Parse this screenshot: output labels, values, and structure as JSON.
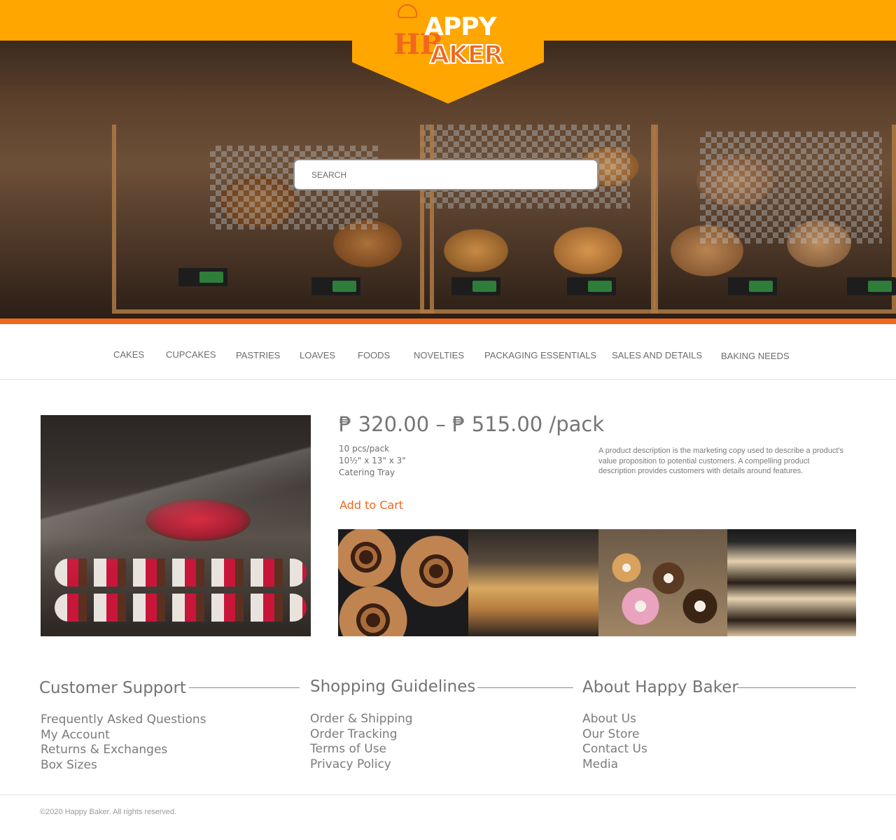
{
  "brand": {
    "logo_line1": "APPY",
    "logo_line2": "AKER",
    "logo_mark": "HB",
    "colors": {
      "orange": "#ffa600",
      "accent": "#f0671d"
    }
  },
  "search": {
    "placeholder": "SEARCH"
  },
  "nav": {
    "items": [
      "CAKES",
      "CUPCAKES",
      "PASTRIES",
      "LOAVES",
      "FOODS",
      "NOVELTIES",
      "PACKAGING ESSENTIALS",
      "SALES AND DETAILS",
      "BAKING NEEDS"
    ]
  },
  "product": {
    "price": "₱ 320.00 – ₱ 515.00 /pack",
    "spec_pack": "10 pcs/pack",
    "spec_size": "10½\" x 13\" x 3\"",
    "spec_type": "Catering Tray",
    "description": "A product description is the marketing copy used to describe a product's value proposition to potential customers. A compelling product description provides customers with details around features.",
    "add_to_cart": "Add to Cart"
  },
  "footer": {
    "columns": [
      {
        "title": "Customer Support",
        "links": [
          "Frequently Asked Questions",
          "My Account",
          "Returns & Exchanges",
          "Box Sizes"
        ]
      },
      {
        "title": "Shopping Guidelines",
        "links": [
          "Order & Shipping",
          "Order Tracking",
          "Terms of Use",
          "Privacy Policy"
        ]
      },
      {
        "title": "About Happy Baker",
        "links": [
          "About Us",
          "Our Store",
          "Contact Us",
          "Media"
        ]
      }
    ],
    "copyright": "©2020 Happy Baker. All rights reserved."
  }
}
